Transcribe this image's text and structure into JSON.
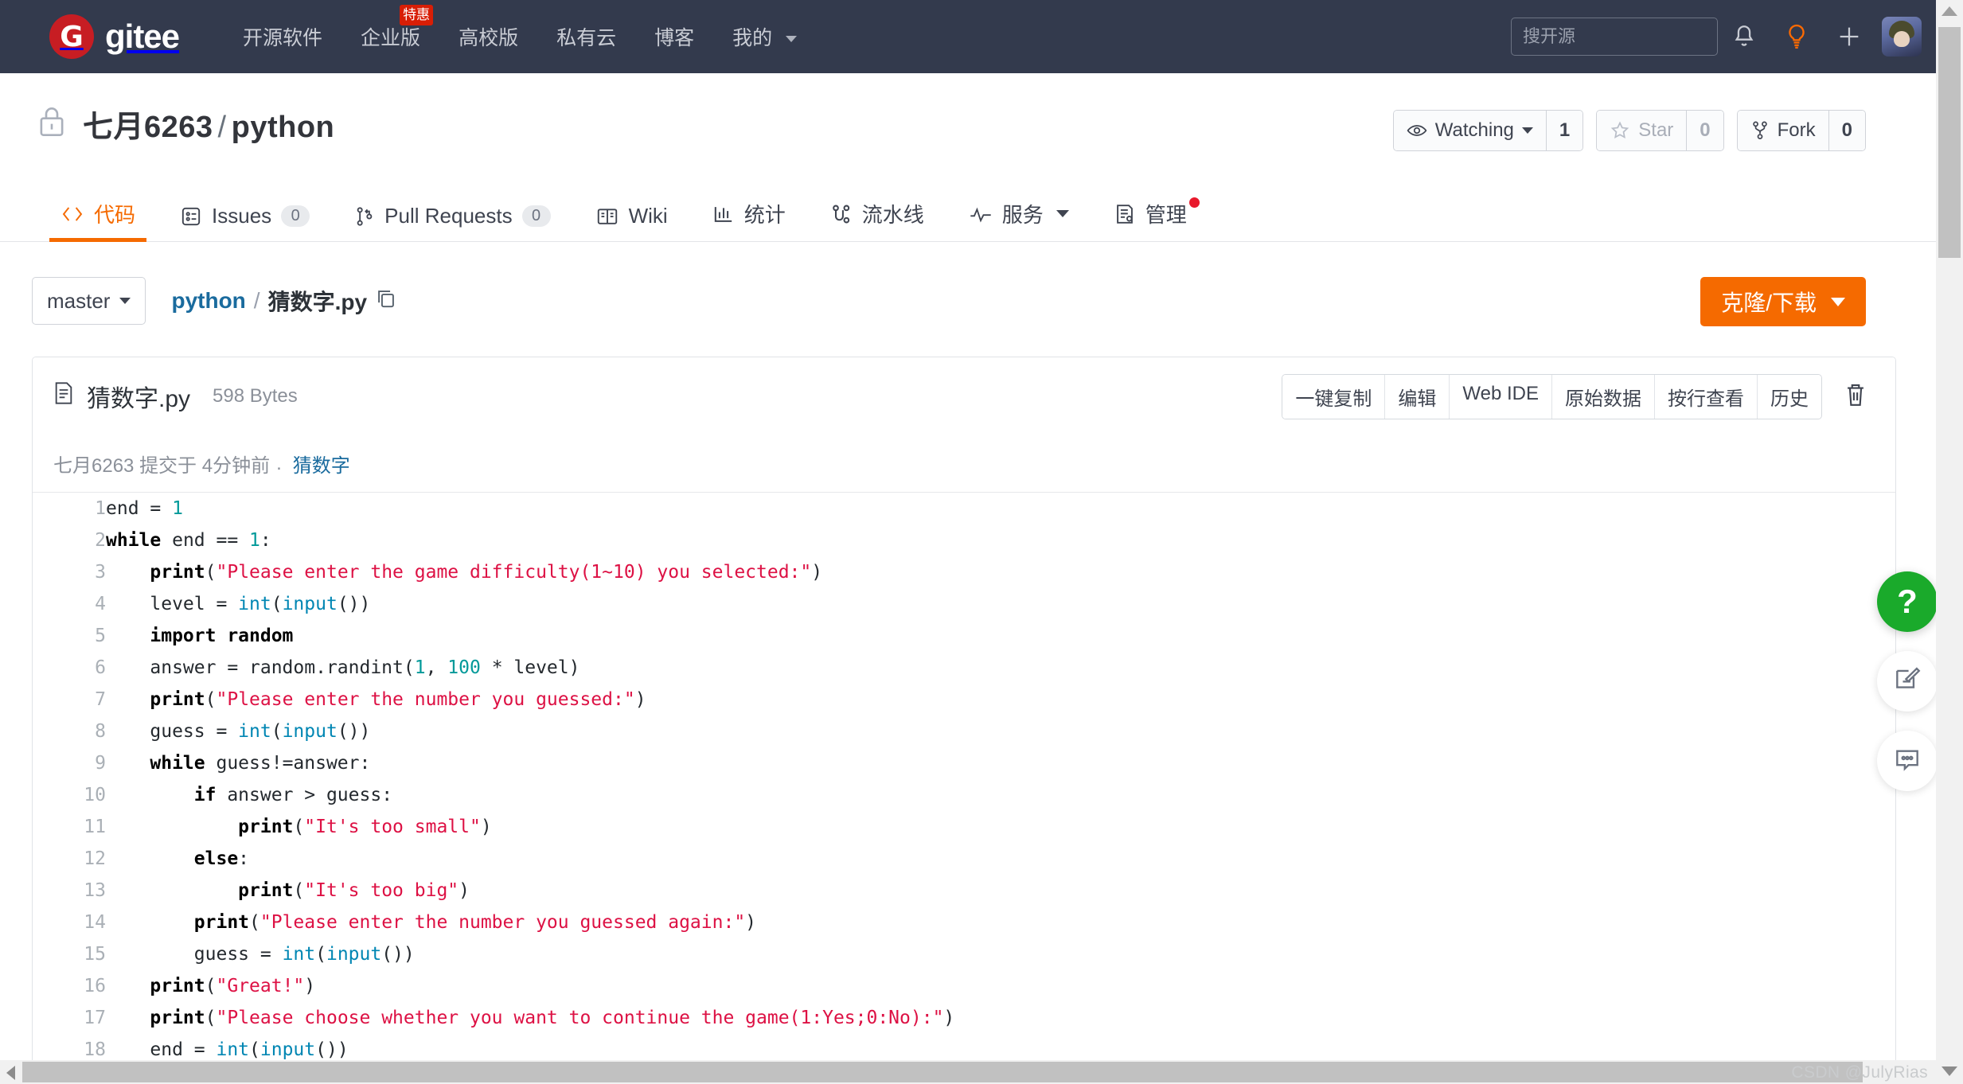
{
  "topbar": {
    "brand": "gitee",
    "brand_mark": "G",
    "nav": [
      {
        "label": "开源软件",
        "badge": null,
        "caret": false
      },
      {
        "label": "企业版",
        "badge": "特惠",
        "caret": false
      },
      {
        "label": "高校版",
        "badge": null,
        "caret": false
      },
      {
        "label": "私有云",
        "badge": null,
        "caret": false
      },
      {
        "label": "博客",
        "badge": null,
        "caret": false
      },
      {
        "label": "我的",
        "badge": null,
        "caret": true
      }
    ],
    "search_placeholder": "搜开源",
    "icons": [
      "bell-icon",
      "lightbulb-icon",
      "plus-icon",
      "avatar"
    ],
    "accent_color": "#c71d23",
    "bar_color": "#333a4d"
  },
  "repo": {
    "visibility_icon": "lock-icon",
    "owner": "七月6263",
    "separator": "/",
    "name": "python",
    "actions": {
      "watch_label": "Watching",
      "watch_count": "1",
      "star_label": "Star",
      "star_count": "0",
      "fork_label": "Fork",
      "fork_count": "0"
    }
  },
  "tabs": [
    {
      "label": "代码",
      "icon": "code-icon",
      "count": null,
      "active": true,
      "caret": false,
      "dot": false
    },
    {
      "label": "Issues",
      "icon": "issue-icon",
      "count": "0",
      "active": false,
      "caret": false,
      "dot": false
    },
    {
      "label": "Pull Requests",
      "icon": "pull-request-icon",
      "count": "0",
      "active": false,
      "caret": false,
      "dot": false
    },
    {
      "label": "Wiki",
      "icon": "book-icon",
      "count": null,
      "active": false,
      "caret": false,
      "dot": false
    },
    {
      "label": "统计",
      "icon": "chart-icon",
      "count": null,
      "active": false,
      "caret": false,
      "dot": false
    },
    {
      "label": "流水线",
      "icon": "pipeline-icon",
      "count": null,
      "active": false,
      "caret": false,
      "dot": false
    },
    {
      "label": "服务",
      "icon": "pulse-icon",
      "count": null,
      "active": false,
      "caret": true,
      "dot": false
    },
    {
      "label": "管理",
      "icon": "manage-icon",
      "count": null,
      "active": false,
      "caret": false,
      "dot": true
    }
  ],
  "breadcrumb": {
    "branch": "master",
    "dir": "python",
    "slash": "/",
    "file": "猜数字.py",
    "copy_icon": "copy-icon",
    "clone_button": "克隆/下载"
  },
  "file": {
    "icon": "file-icon",
    "name": "猜数字.py",
    "size": "598 Bytes",
    "tools": [
      "一键复制",
      "编辑",
      "Web IDE",
      "原始数据",
      "按行查看",
      "历史"
    ],
    "delete_icon": "trash-icon",
    "commit_author": "七月6263",
    "commit_verb": "提交于",
    "commit_time": "4分钟前",
    "commit_dot": ".",
    "commit_message": "猜数字"
  },
  "code": {
    "language": "python",
    "lines": [
      {
        "n": "1",
        "tokens": [
          {
            "t": "end = ",
            "c": ""
          },
          {
            "t": "1",
            "c": "n"
          }
        ]
      },
      {
        "n": "2",
        "tokens": [
          {
            "t": "while",
            "c": "k"
          },
          {
            "t": " end == ",
            "c": ""
          },
          {
            "t": "1",
            "c": "n"
          },
          {
            "t": ":",
            "c": ""
          }
        ]
      },
      {
        "n": "3",
        "tokens": [
          {
            "t": "    ",
            "c": ""
          },
          {
            "t": "print",
            "c": "fn"
          },
          {
            "t": "(",
            "c": ""
          },
          {
            "t": "\"Please enter the game difficulty(1~10) you selected:\"",
            "c": "s"
          },
          {
            "t": ")",
            "c": ""
          }
        ]
      },
      {
        "n": "4",
        "tokens": [
          {
            "t": "    level = ",
            "c": ""
          },
          {
            "t": "int",
            "c": "b"
          },
          {
            "t": "(",
            "c": ""
          },
          {
            "t": "input",
            "c": "b"
          },
          {
            "t": "())",
            "c": ""
          }
        ]
      },
      {
        "n": "5",
        "tokens": [
          {
            "t": "    ",
            "c": ""
          },
          {
            "t": "import random",
            "c": "mod"
          }
        ]
      },
      {
        "n": "6",
        "tokens": [
          {
            "t": "    answer = random.randint(",
            "c": ""
          },
          {
            "t": "1",
            "c": "n"
          },
          {
            "t": ", ",
            "c": ""
          },
          {
            "t": "100",
            "c": "n"
          },
          {
            "t": " * level)",
            "c": ""
          }
        ]
      },
      {
        "n": "7",
        "tokens": [
          {
            "t": "    ",
            "c": ""
          },
          {
            "t": "print",
            "c": "fn"
          },
          {
            "t": "(",
            "c": ""
          },
          {
            "t": "\"Please enter the number you guessed:\"",
            "c": "s"
          },
          {
            "t": ")",
            "c": ""
          }
        ]
      },
      {
        "n": "8",
        "tokens": [
          {
            "t": "    guess = ",
            "c": ""
          },
          {
            "t": "int",
            "c": "b"
          },
          {
            "t": "(",
            "c": ""
          },
          {
            "t": "input",
            "c": "b"
          },
          {
            "t": "())",
            "c": ""
          }
        ]
      },
      {
        "n": "9",
        "tokens": [
          {
            "t": "    ",
            "c": ""
          },
          {
            "t": "while",
            "c": "k"
          },
          {
            "t": " guess!=answer:",
            "c": ""
          }
        ]
      },
      {
        "n": "10",
        "tokens": [
          {
            "t": "        ",
            "c": ""
          },
          {
            "t": "if",
            "c": "k"
          },
          {
            "t": " answer > guess:",
            "c": ""
          }
        ]
      },
      {
        "n": "11",
        "tokens": [
          {
            "t": "            ",
            "c": ""
          },
          {
            "t": "print",
            "c": "fn"
          },
          {
            "t": "(",
            "c": ""
          },
          {
            "t": "\"It's too small\"",
            "c": "s"
          },
          {
            "t": ")",
            "c": ""
          }
        ]
      },
      {
        "n": "12",
        "tokens": [
          {
            "t": "        ",
            "c": ""
          },
          {
            "t": "else",
            "c": "k"
          },
          {
            "t": ":",
            "c": ""
          }
        ]
      },
      {
        "n": "13",
        "tokens": [
          {
            "t": "            ",
            "c": ""
          },
          {
            "t": "print",
            "c": "fn"
          },
          {
            "t": "(",
            "c": ""
          },
          {
            "t": "\"It's too big\"",
            "c": "s"
          },
          {
            "t": ")",
            "c": ""
          }
        ]
      },
      {
        "n": "14",
        "tokens": [
          {
            "t": "        ",
            "c": ""
          },
          {
            "t": "print",
            "c": "fn"
          },
          {
            "t": "(",
            "c": ""
          },
          {
            "t": "\"Please enter the number you guessed again:\"",
            "c": "s"
          },
          {
            "t": ")",
            "c": ""
          }
        ]
      },
      {
        "n": "15",
        "tokens": [
          {
            "t": "        guess = ",
            "c": ""
          },
          {
            "t": "int",
            "c": "b"
          },
          {
            "t": "(",
            "c": ""
          },
          {
            "t": "input",
            "c": "b"
          },
          {
            "t": "())",
            "c": ""
          }
        ]
      },
      {
        "n": "16",
        "tokens": [
          {
            "t": "    ",
            "c": ""
          },
          {
            "t": "print",
            "c": "fn"
          },
          {
            "t": "(",
            "c": ""
          },
          {
            "t": "\"Great!\"",
            "c": "s"
          },
          {
            "t": ")",
            "c": ""
          }
        ]
      },
      {
        "n": "17",
        "tokens": [
          {
            "t": "    ",
            "c": ""
          },
          {
            "t": "print",
            "c": "fn"
          },
          {
            "t": "(",
            "c": ""
          },
          {
            "t": "\"Please choose whether you want to continue the game(1:Yes;0:No):\"",
            "c": "s"
          },
          {
            "t": ")",
            "c": ""
          }
        ]
      },
      {
        "n": "18",
        "tokens": [
          {
            "t": "    end = ",
            "c": ""
          },
          {
            "t": "int",
            "c": "b"
          },
          {
            "t": "(",
            "c": ""
          },
          {
            "t": "input",
            "c": "b"
          },
          {
            "t": "())",
            "c": ""
          }
        ]
      }
    ]
  },
  "fabs": [
    {
      "icon": "question-mark-icon",
      "label": "?"
    },
    {
      "icon": "feedback-edit-icon",
      "label": ""
    },
    {
      "icon": "chat-bubble-icon",
      "label": ""
    }
  ],
  "watermark": "CSDN @JulyRias"
}
